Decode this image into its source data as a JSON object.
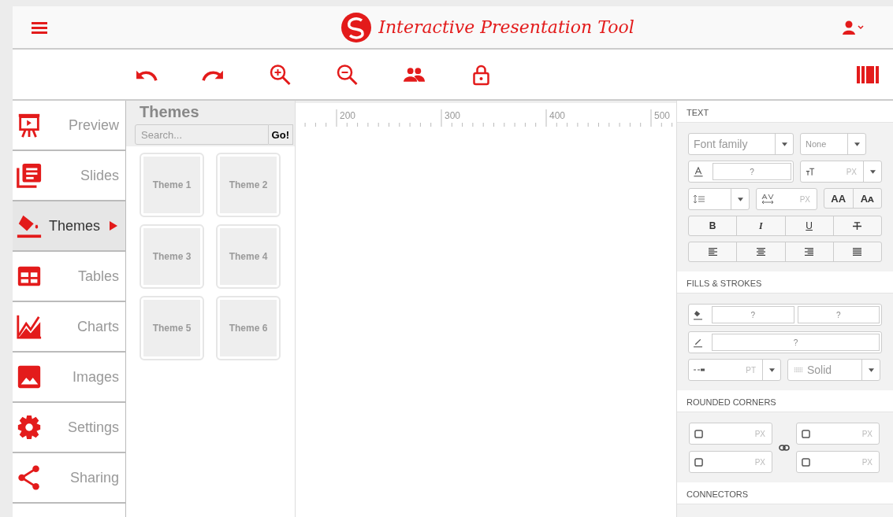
{
  "header": {
    "title": "Interactive Presentation Tool"
  },
  "sidebar": {
    "items": [
      {
        "label": "Preview",
        "selected": false
      },
      {
        "label": "Slides",
        "selected": false
      },
      {
        "label": "Themes",
        "selected": true
      },
      {
        "label": "Tables",
        "selected": false
      },
      {
        "label": "Charts",
        "selected": false
      },
      {
        "label": "Images",
        "selected": false
      },
      {
        "label": "Settings",
        "selected": false
      },
      {
        "label": "Sharing",
        "selected": false
      }
    ]
  },
  "themes_panel": {
    "title": "Themes",
    "search": {
      "placeholder": "Search..."
    },
    "go_button": "Go!",
    "themes": [
      "Theme 1",
      "Theme 2",
      "Theme 3",
      "Theme 4",
      "Theme 5",
      "Theme 6"
    ]
  },
  "ruler": {
    "labels": [
      "200",
      "300",
      "400",
      "500"
    ]
  },
  "properties": {
    "text": {
      "title": "TEXT",
      "font_family": {
        "placeholder": "Font family"
      },
      "font_style": "None",
      "color_value": "?",
      "size_unit": "PX",
      "spacing_unit": "PX",
      "caps_buttons": [
        "AA",
        "Aᴀ"
      ],
      "style_buttons": [
        "B",
        "I",
        "U"
      ]
    },
    "fills": {
      "title": "FILLS & STROKES",
      "fill_values": [
        "?",
        "?"
      ],
      "stroke_value": "?",
      "width_unit": "PT",
      "line_style": "Solid"
    },
    "corners": {
      "title": "ROUNDED CORNERS",
      "units": [
        "PX",
        "PX",
        "PX",
        "PX"
      ]
    },
    "connectors": {
      "title": "CONNECTORS"
    }
  }
}
